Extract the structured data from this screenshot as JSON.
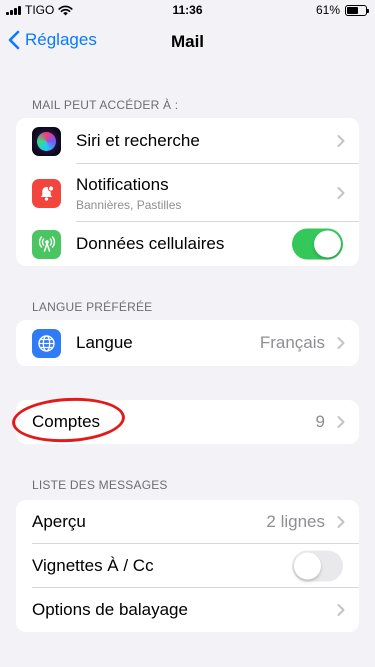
{
  "status_bar": {
    "carrier": "TIGO",
    "time": "11:36",
    "battery": "61%",
    "battery_level": 0.61
  },
  "nav": {
    "back_label": "Réglages",
    "title": "Mail"
  },
  "sections": {
    "access": {
      "header": "MAIL PEUT ACCÉDER À :",
      "rows": [
        {
          "title": "Siri et recherche",
          "icon": "siri-icon"
        },
        {
          "title": "Notifications",
          "subtitle": "Bannières, Pastilles",
          "icon": "notifications-icon"
        },
        {
          "title": "Données cellulaires",
          "icon": "cellular-icon",
          "toggle": true
        }
      ]
    },
    "language": {
      "header": "LANGUE PRÉFÉRÉE",
      "rows": [
        {
          "title": "Langue",
          "value": "Français",
          "icon": "globe-icon"
        }
      ]
    },
    "accounts": {
      "rows": [
        {
          "title": "Comptes",
          "value": "9"
        }
      ]
    },
    "messages": {
      "header": "LISTE DES MESSAGES",
      "rows": [
        {
          "title": "Aperçu",
          "value": "2 lignes"
        },
        {
          "title": "Vignettes À / Cc",
          "toggle": false
        },
        {
          "title": "Options de balayage"
        }
      ]
    }
  },
  "colors": {
    "accent": "#0a7aff",
    "toggle_on": "#34c759",
    "highlight": "#e31a1a"
  }
}
